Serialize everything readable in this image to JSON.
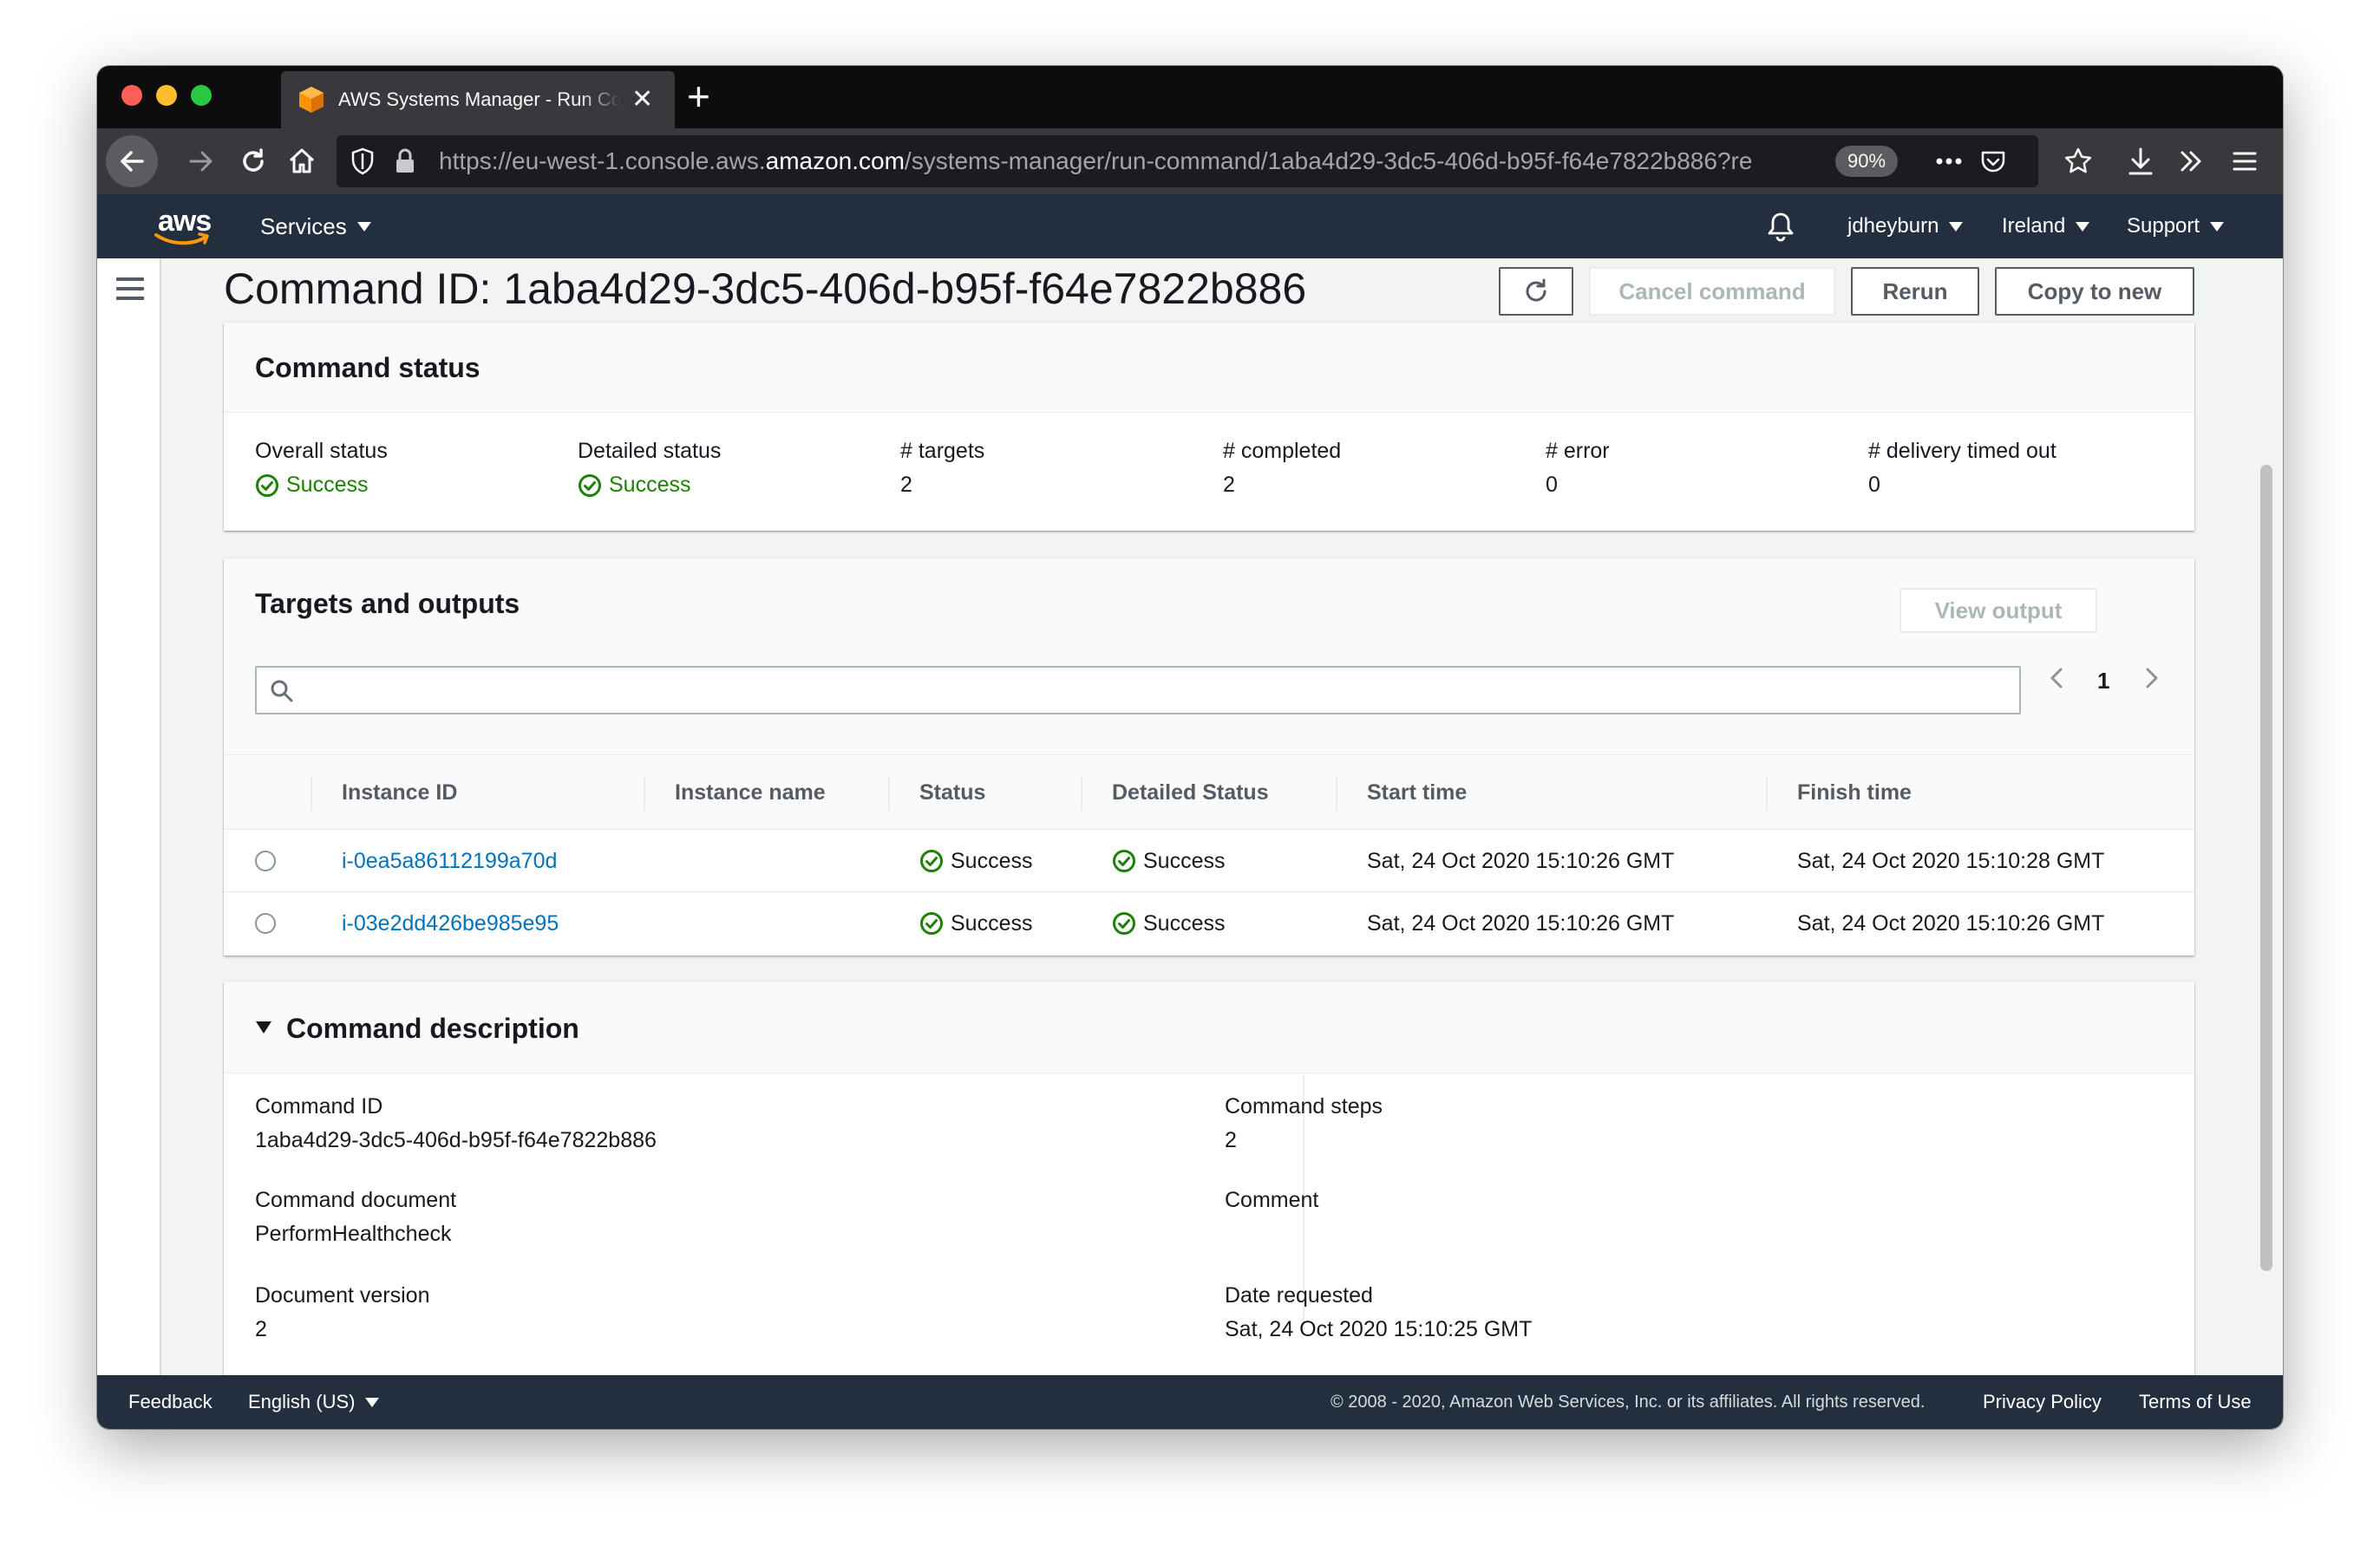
{
  "browser": {
    "tab_title": "AWS Systems Manager - Run Command",
    "url_prefix": "https://eu-west-1.console.aws.",
    "url_domain": "amazon.com",
    "url_path": "/systems-manager/run-command/1aba4d29-3dc5-406d-b95f-f64e7822b886?re",
    "zoom": "90%"
  },
  "aws_nav": {
    "logo_text": "aws",
    "services_label": "Services",
    "user_label": "jdheyburn",
    "region_label": "Ireland",
    "support_label": "Support"
  },
  "page": {
    "title": "Command ID: 1aba4d29-3dc5-406d-b95f-f64e7822b886",
    "cancel_label": "Cancel command",
    "rerun_label": "Rerun",
    "copy_label": "Copy to new"
  },
  "command_status": {
    "title": "Command status",
    "overall_label": "Overall status",
    "overall_value": "Success",
    "detailed_label": "Detailed status",
    "detailed_value": "Success",
    "targets_label": "# targets",
    "targets_value": "2",
    "completed_label": "# completed",
    "completed_value": "2",
    "error_label": "# error",
    "error_value": "0",
    "timedout_label": "# delivery timed out",
    "timedout_value": "0"
  },
  "targets": {
    "title": "Targets and outputs",
    "view_output_label": "View output",
    "search_placeholder": "",
    "page_number": "1",
    "columns": [
      "Instance ID",
      "Instance name",
      "Status",
      "Detailed Status",
      "Start time",
      "Finish time"
    ],
    "rows": [
      {
        "instance_id": "i-0ea5a86112199a70d",
        "instance_name": "",
        "status": "Success",
        "detailed_status": "Success",
        "start_time": "Sat, 24 Oct 2020 15:10:26 GMT",
        "finish_time": "Sat, 24 Oct 2020 15:10:28 GMT"
      },
      {
        "instance_id": "i-03e2dd426be985e95",
        "instance_name": "",
        "status": "Success",
        "detailed_status": "Success",
        "start_time": "Sat, 24 Oct 2020 15:10:26 GMT",
        "finish_time": "Sat, 24 Oct 2020 15:10:26 GMT"
      }
    ]
  },
  "description": {
    "title": "Command description",
    "command_id_label": "Command ID",
    "command_id_value": "1aba4d29-3dc5-406d-b95f-f64e7822b886",
    "document_label": "Command document",
    "document_value": "PerformHealthcheck",
    "version_label": "Document version",
    "version_value": "2",
    "steps_label": "Command steps",
    "steps_value": "2",
    "comment_label": "Comment",
    "comment_value": "",
    "requested_label": "Date requested",
    "requested_value": "Sat, 24 Oct 2020 15:10:25 GMT"
  },
  "footer": {
    "feedback_label": "Feedback",
    "language_label": "English (US)",
    "copyright": "© 2008 - 2020, Amazon Web Services, Inc. or its affiliates. All rights reserved.",
    "privacy_label": "Privacy Policy",
    "terms_label": "Terms of Use"
  },
  "colors": {
    "nav_bg": "#232f3e",
    "success": "#1d8102",
    "link": "#0073bb",
    "page_bg": "#f2f3f3"
  },
  "icons": {
    "tab_favicon": "aws-cube-icon",
    "back": "arrow-left-icon",
    "forward": "arrow-right-icon",
    "reload": "reload-icon",
    "home": "home-icon",
    "shield": "shield-icon",
    "lock": "lock-icon",
    "more": "more-dots-icon",
    "pocket": "pocket-icon",
    "bookmark": "star-icon",
    "download": "download-icon",
    "overflow": "double-chevron-icon",
    "menu": "hamburger-icon",
    "bell": "bell-icon",
    "refresh": "refresh-icon",
    "search": "search-icon",
    "status_ok": "check-circle-icon"
  }
}
